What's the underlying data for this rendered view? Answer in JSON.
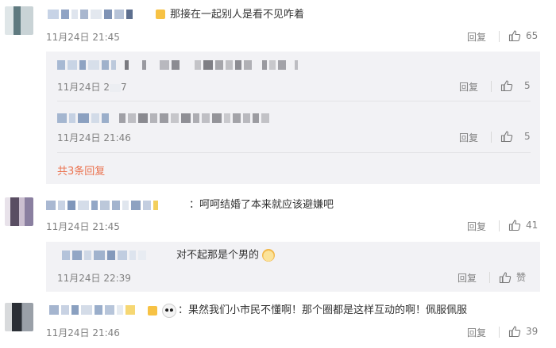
{
  "comments": [
    {
      "text": "那接在一起别人是看不见咋着",
      "time": "11月24日 21:45",
      "reply": "回复",
      "likes": "65"
    },
    {
      "text": "：呵呵结婚了本来就应该避嫌吧",
      "time": "11月24日 21:45",
      "reply": "回复",
      "likes": "41"
    },
    {
      "text": "：果然我们小市民不懂啊！那个圈都是这样互动的啊！佩服佩服",
      "time": "11月24日 21:46",
      "reply": "回复",
      "likes": "39"
    }
  ],
  "sub_replies_1": [
    {
      "time": "11月24日 2",
      "time_tail": "7",
      "reply": "回复",
      "likes": "5"
    },
    {
      "time": "11月24日 21:46",
      "reply": "回复",
      "likes": "5"
    }
  ],
  "sub_more": "共3条回复",
  "sub_reply_2": {
    "text": "对不起那是个男的",
    "time": "11月24日 22:39",
    "reply": "回复",
    "likes": "赞"
  },
  "colors": {
    "accent": "#eb7350",
    "muted": "#808080",
    "subbg": "#f2f2f5"
  },
  "icons": [
    "thumb-up-icon",
    "cat-emoji-icon",
    "panda-emoji-icon",
    "crown-badge-icon"
  ]
}
